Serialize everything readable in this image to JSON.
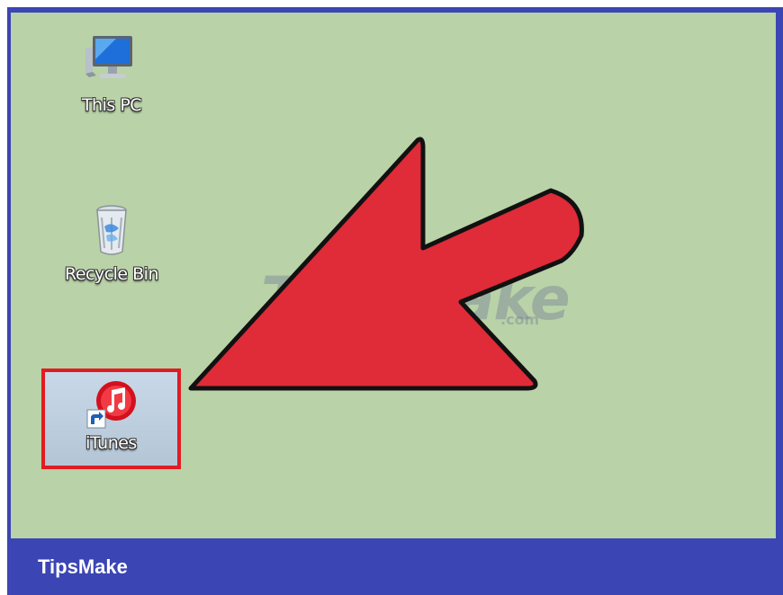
{
  "desktop": {
    "icons": [
      {
        "label": "This PC",
        "icon": "this-pc-icon"
      },
      {
        "label": "Recycle Bin",
        "icon": "recycle-bin-icon"
      },
      {
        "label": "iTunes",
        "icon": "itunes-icon",
        "highlighted": true
      }
    ],
    "background_color": "#b9d2a7"
  },
  "annotation": {
    "arrow_color": "#e02b38",
    "highlight_color": "#e11b22"
  },
  "watermark": {
    "text": "TipsMake",
    "suffix": ".com"
  },
  "footer": {
    "brand": "TipsMake",
    "background_color": "#3b45b4"
  }
}
